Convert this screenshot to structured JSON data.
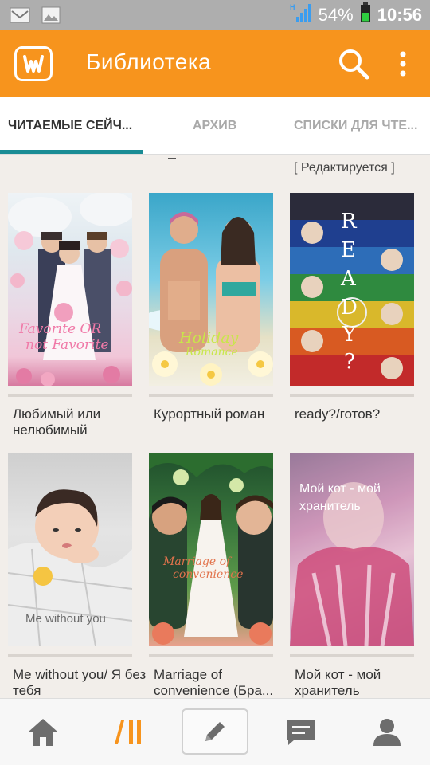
{
  "status_bar": {
    "battery_percent": "54%",
    "time": "10:56",
    "colors": {
      "bar": "#aeaeae",
      "battery": "#2ecc40"
    }
  },
  "app_bar": {
    "title": "Библиотека",
    "accent_color": "#f7941d",
    "icons": [
      "wattpad-logo-icon",
      "search-icon",
      "more-vert-icon"
    ]
  },
  "tabs": [
    {
      "label": "ЧИТАЕМЫЕ СЕЙЧ...",
      "active": true
    },
    {
      "label": "АРХИВ",
      "active": false
    },
    {
      "label": "СПИСКИ ДЛЯ ЧТЕ...",
      "active": false
    }
  ],
  "above_grid": {
    "status": "[ Редактируется ]"
  },
  "books": [
    {
      "title": "Любимый или нелюбимый",
      "cover_text": "Favorite OR not Favorite"
    },
    {
      "title": "Курортный роман",
      "cover_text": "Holiday Romance"
    },
    {
      "title": "ready?/готов?",
      "cover_text": "READY?"
    },
    {
      "title": "Me without you/ Я без тебя",
      "cover_text": "Me without you"
    },
    {
      "title": "Marriage of convenience (Бра...",
      "cover_text": "Marriage of convenience"
    },
    {
      "title": "Мой кот - мой хранитель",
      "cover_text": "Мой кот - мой хранитель"
    }
  ],
  "bottom_nav": [
    {
      "name": "home",
      "icon": "home-icon"
    },
    {
      "name": "library",
      "icon": "library-icon",
      "active": true
    },
    {
      "name": "write",
      "icon": "pencil-icon"
    },
    {
      "name": "messages",
      "icon": "chat-icon"
    },
    {
      "name": "profile",
      "icon": "person-icon"
    }
  ]
}
